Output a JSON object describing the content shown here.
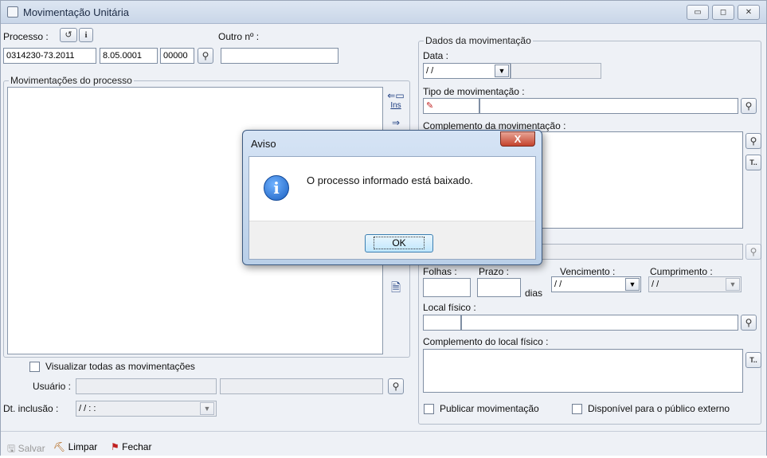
{
  "window": {
    "title": "Movimentação Unitária",
    "buttons": [
      "▭",
      "◻",
      "✕"
    ]
  },
  "left": {
    "processo_label": "Processo :",
    "outro_label": "Outro nº :",
    "processo_fields": [
      "0314230-73.2011",
      "8.05.0001",
      "00000"
    ],
    "outro_value": "",
    "movs_group_title": "Movimentações do processo",
    "side_icons": [
      "⇐▭",
      "Ins",
      "⇒"
    ],
    "visualizar_label": "Visualizar todas as movimentações",
    "usuario_label": "Usuário :",
    "dt_inclusao_label": "Dt. inclusão :",
    "dt_inclusao_value": "/ /     : :"
  },
  "right": {
    "group_title": "Dados da movimentação",
    "data_label": "Data :",
    "data_value": "/ /",
    "tipo_label": "Tipo de movimentação :",
    "complemento_label": "Complemento da movimentação :",
    "folhas_label": "Folhas :",
    "prazo_label": "Prazo :",
    "dias_label": "dias",
    "vencimento_label": "Vencimento :",
    "vencimento_value": "/ /",
    "cumprimento_label": "Cumprimento :",
    "cumprimento_value": "/ /",
    "local_label": "Local físico :",
    "complemento_local_label": "Complemento do local físico :",
    "publicar_label": "Publicar movimentação",
    "disponivel_label": "Disponível para o público externo"
  },
  "footer": {
    "salvar": "Salvar",
    "limpar": "Limpar",
    "fechar": "Fechar"
  },
  "dialog": {
    "title": "Aviso",
    "close": "X",
    "message": "O processo informado está baixado.",
    "ok": "OK"
  }
}
